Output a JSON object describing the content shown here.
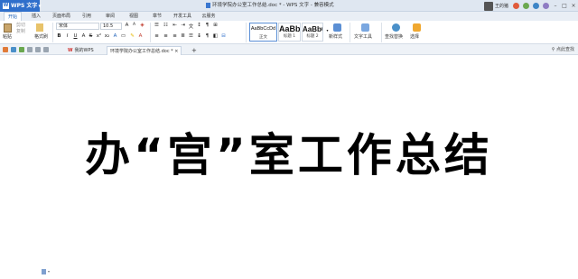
{
  "app": {
    "name": "WPS 文字",
    "window_title": "环境学院办公室工作总结.doc * - WPS 文字 - 兼容模式",
    "user": "王的猪"
  },
  "menu": {
    "tabs": [
      "开始",
      "插入",
      "页面布局",
      "引用",
      "审阅",
      "视图",
      "章节",
      "开发工具",
      "云服务"
    ],
    "active": "开始"
  },
  "ribbon": {
    "paste": "粘贴",
    "cut": "剪切",
    "copy": "复制",
    "format_painter": "格式刷",
    "font_name": "宋体",
    "font_size": "10.5",
    "styles": [
      {
        "sample": "AaBbCcDd",
        "caption": "正文"
      },
      {
        "sample": "AaBb",
        "caption": "标题 1"
      },
      {
        "sample": "AaBbC",
        "caption": "标题 2"
      }
    ],
    "new_style": "新样式",
    "text_tools": "文字工具",
    "find_replace": "查找替换",
    "select": "选择"
  },
  "tabs": {
    "home_tab": "我的WPS",
    "doc_tab": "环境学院办公室工作总结.doc *",
    "search_label": "点此查找"
  },
  "document": {
    "title": "办“宫”室工作总结"
  },
  "colors": {
    "accent": "#2f6fcb",
    "titlebar_bg": "#dfe7f1",
    "wps_red": "#d0312d"
  }
}
